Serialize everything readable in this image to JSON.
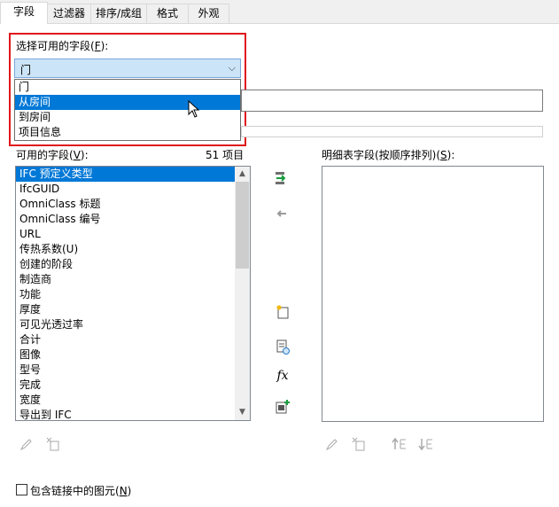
{
  "tabs": [
    "字段",
    "过滤器",
    "排序/成组",
    "格式",
    "外观"
  ],
  "available_from": {
    "label": "选择可用的字段(",
    "mnemonic": "F",
    "label_end": "):",
    "selected": "门",
    "options": [
      "门",
      "从房间",
      "到房间",
      "项目信息"
    ],
    "highlighted_index": 1
  },
  "available_fields": {
    "label": "可用的字段(",
    "mnemonic": "V",
    "label_end": "):",
    "count": "51 项目",
    "items": [
      "IFC 预定义类型",
      "IfcGUID",
      "OmniClass 标题",
      "OmniClass 编号",
      "URL",
      "传热系数(U)",
      "创建的阶段",
      "制造商",
      "功能",
      "厚度",
      "可见光透过率",
      "合计",
      "图像",
      "型号",
      "完成",
      "宽度",
      "导出到 IFC"
    ]
  },
  "scheduled_fields": {
    "label": "明细表字段(按顺序排列)(",
    "mnemonic": "S",
    "label_end": "):"
  },
  "include_linked": {
    "label": "包含链接中的图元(",
    "mnemonic": "N",
    "label_end": ")",
    "checked": false
  },
  "icons": {
    "add_parameter": "add-field-arrow-icon",
    "remove_parameter": "remove-field-arrow-icon",
    "new_parameter": "new-parameter-icon",
    "combine_parameters": "combine-parameters-icon",
    "calculated_value": "fx-icon",
    "add_to_schedule": "add-to-schedule-icon",
    "edit": "pencil-icon",
    "delete": "delete-parameter-icon",
    "move_up": "move-up-icon",
    "move_down": "move-down-icon"
  },
  "colors": {
    "highlight_border": "#e0161b",
    "selection": "#0078d7",
    "combo_bg": "#cce4f7"
  }
}
